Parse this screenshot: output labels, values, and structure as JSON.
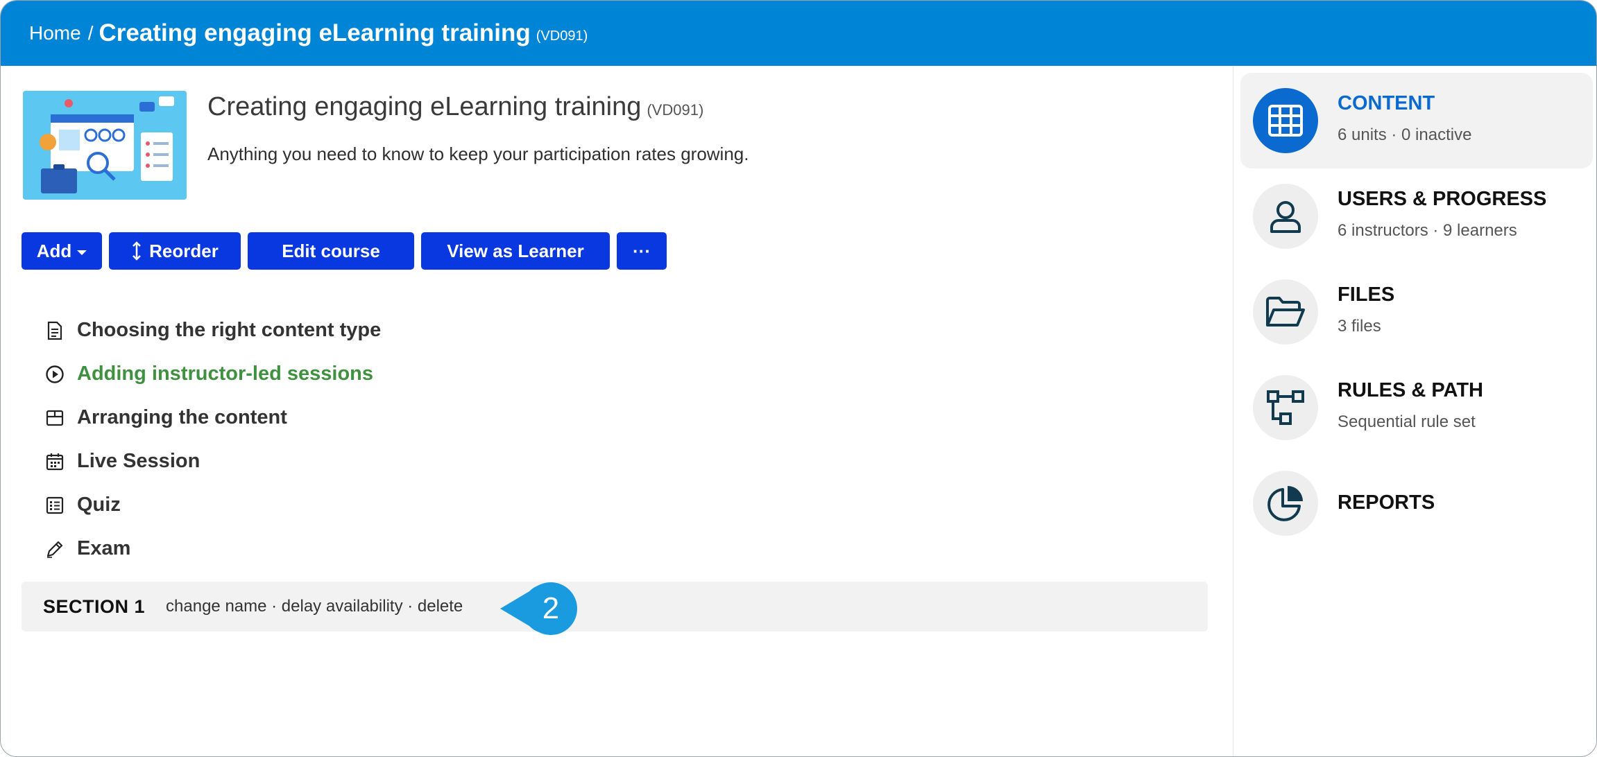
{
  "breadcrumb": {
    "home": "Home",
    "separator": "/",
    "current": "Creating engaging eLearning training",
    "code": "(VD091)"
  },
  "course": {
    "title": "Creating engaging eLearning training",
    "code": "(VD091)",
    "description": "Anything you need to know to keep your participation rates growing."
  },
  "toolbar": {
    "add": "Add",
    "reorder": "Reorder",
    "edit": "Edit course",
    "view": "View as Learner",
    "more": "···"
  },
  "units": [
    {
      "label": "Choosing the right content type",
      "icon": "document-icon"
    },
    {
      "label": "Adding instructor-led sessions",
      "icon": "play-circle-icon",
      "active": true
    },
    {
      "label": "Arranging the content",
      "icon": "box-icon"
    },
    {
      "label": "Live Session",
      "icon": "calendar-icon"
    },
    {
      "label": "Quiz",
      "icon": "checklist-icon"
    },
    {
      "label": "Exam",
      "icon": "pencil-icon"
    }
  ],
  "section": {
    "name": "SECTION 1",
    "actions": "change name · delay availability · delete"
  },
  "callout": {
    "number": "2"
  },
  "sidebar": {
    "items": [
      {
        "title": "CONTENT",
        "subtitle": "6 units · 0 inactive",
        "icon": "grid-icon",
        "selected": true
      },
      {
        "title": "USERS & PROGRESS",
        "subtitle": "6 instructors · 9 learners",
        "icon": "user-icon"
      },
      {
        "title": "FILES",
        "subtitle": "3 files",
        "icon": "folder-icon"
      },
      {
        "title": "RULES & PATH",
        "subtitle": "Sequential rule set",
        "icon": "flow-icon"
      },
      {
        "title": "REPORTS",
        "subtitle": "",
        "icon": "pie-chart-icon"
      }
    ]
  },
  "colors": {
    "header": "#0085d6",
    "button": "#0a38e0",
    "active_unit": "#3f9140",
    "selected_nav": "#0a6ad0",
    "callout": "#1a9be0"
  }
}
